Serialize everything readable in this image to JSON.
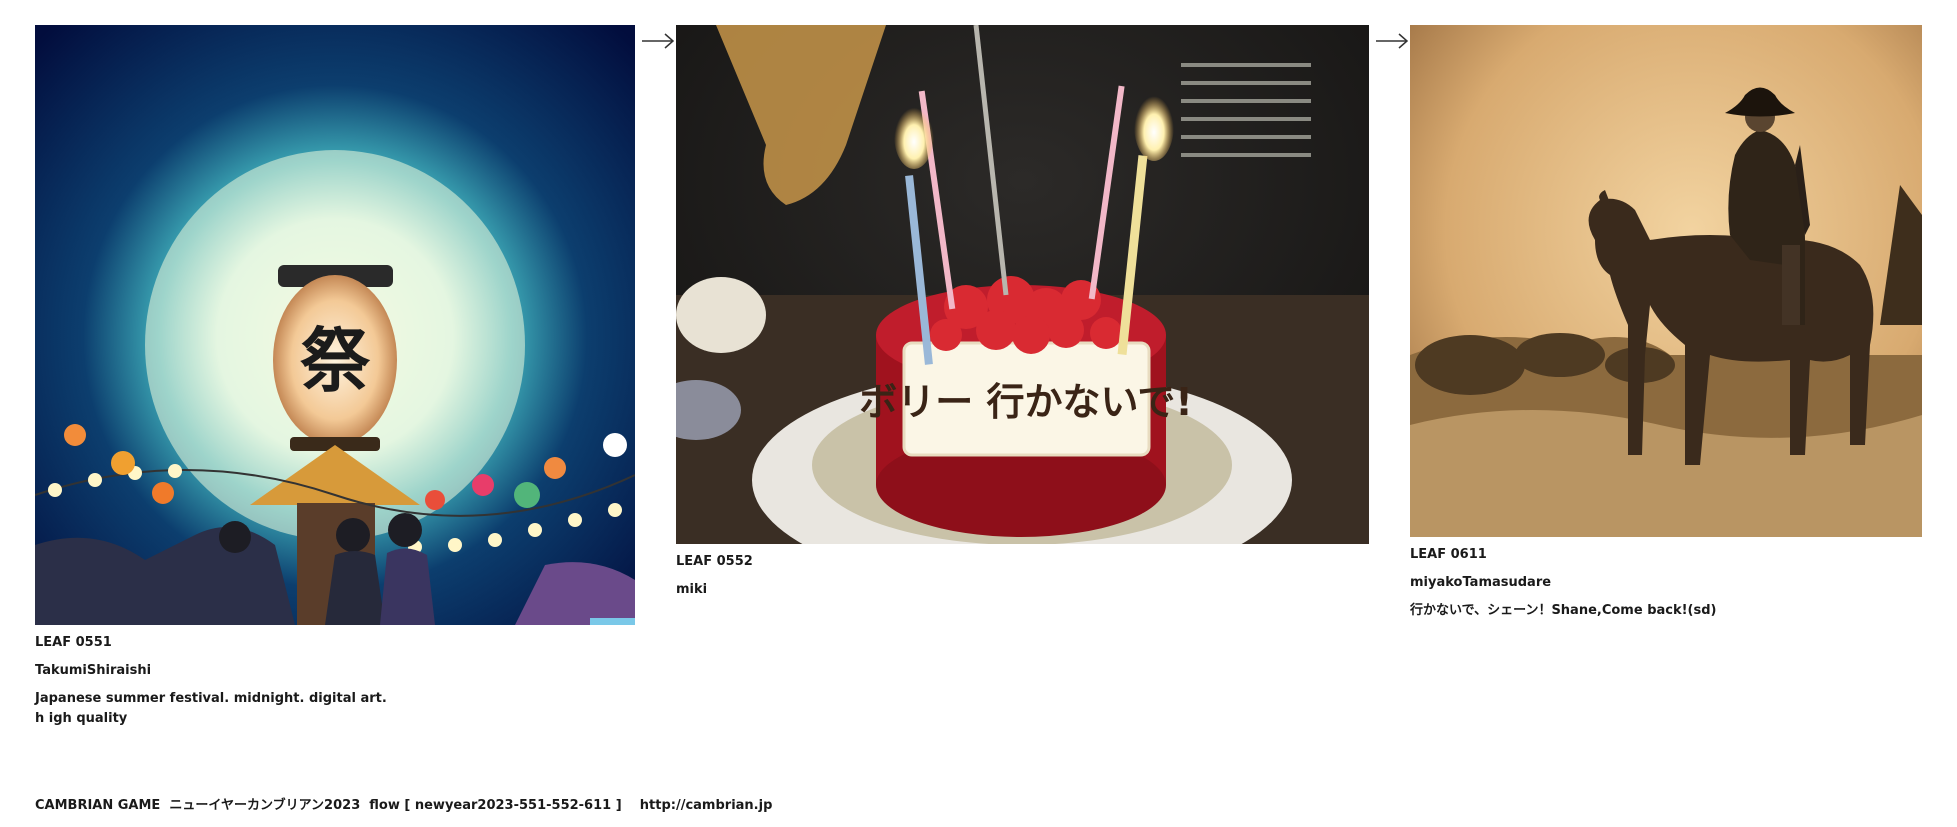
{
  "leaves": [
    {
      "id": "LEAF 0551",
      "author": "TakumiShiraishi",
      "title": "Japanese summer festival. midnight. digital art. h igh quality",
      "image_icon": "festival-lantern-image"
    },
    {
      "id": "LEAF 0552",
      "author": "miki",
      "title": "",
      "image_icon": "birthday-cake-image"
    },
    {
      "id": "LEAF 0611",
      "author": "miyakoTamasudare",
      "title": "行かないで、シェーン！Shane,Come back!(sd)",
      "image_icon": "cowboy-horse-image"
    }
  ],
  "cake_plaque_text": "ボリー 行かないで!",
  "footer": {
    "text": "CAMBRIAN GAME  ニューイヤーカンブリアン2023  flow [ newyear2023-551-552-611 ]    http://cambrian.jp"
  }
}
